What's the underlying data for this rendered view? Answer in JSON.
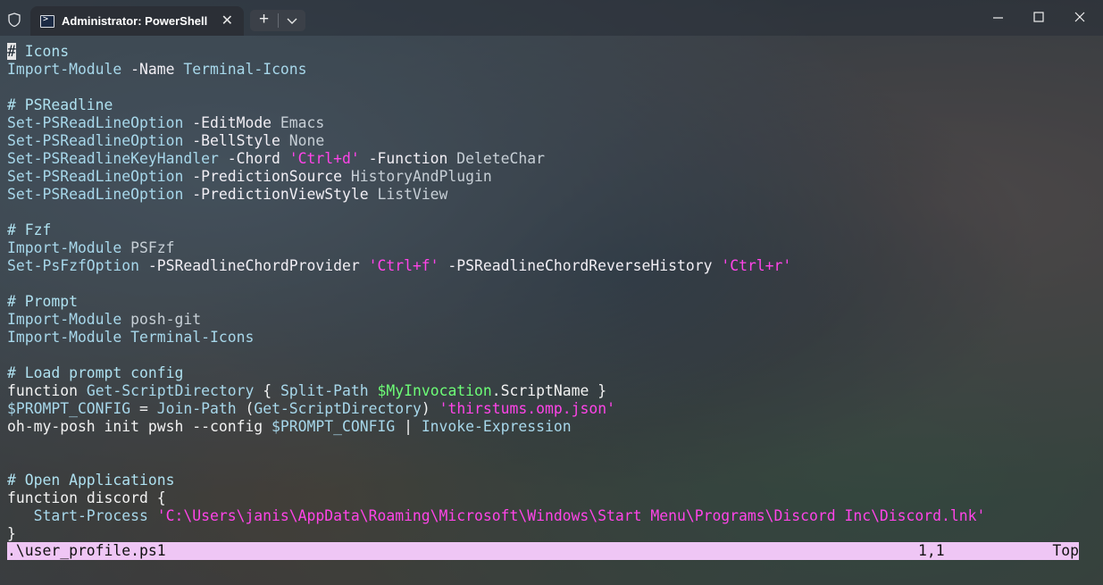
{
  "window": {
    "tab_title": "Administrator: PowerShell",
    "tab_icon": "powershell-icon",
    "caption_icons": [
      "minimize-icon",
      "maximize-icon",
      "close-icon"
    ]
  },
  "editor": {
    "lines": [
      [
        {
          "t": "#",
          "c": "cursor"
        },
        {
          "t": " Icons",
          "c": "c-com"
        }
      ],
      [
        {
          "t": "Import-Module",
          "c": "c-cmd"
        },
        {
          "t": " -Name",
          "c": "c-param"
        },
        {
          "t": " Terminal-Icons",
          "c": "c-cmd"
        }
      ],
      [],
      [
        {
          "t": "# PSReadline",
          "c": "c-com"
        }
      ],
      [
        {
          "t": "Set-PSReadLineOption",
          "c": "c-cmd"
        },
        {
          "t": " -EditMode",
          "c": "c-param"
        },
        {
          "t": " Emacs",
          "c": "c-arg"
        }
      ],
      [
        {
          "t": "Set-PSReadlineOption",
          "c": "c-cmd"
        },
        {
          "t": " -BellStyle",
          "c": "c-param"
        },
        {
          "t": " None",
          "c": "c-arg"
        }
      ],
      [
        {
          "t": "Set-PSReadlineKeyHandler",
          "c": "c-cmd"
        },
        {
          "t": " -Chord",
          "c": "c-param"
        },
        {
          "t": " 'Ctrl+d'",
          "c": "c-str"
        },
        {
          "t": " -Function",
          "c": "c-param"
        },
        {
          "t": " DeleteChar",
          "c": "c-arg"
        }
      ],
      [
        {
          "t": "Set-PSReadLineOption",
          "c": "c-cmd"
        },
        {
          "t": " -PredictionSource",
          "c": "c-param"
        },
        {
          "t": " HistoryAndPlugin",
          "c": "c-arg"
        }
      ],
      [
        {
          "t": "Set-PSReadLineOption",
          "c": "c-cmd"
        },
        {
          "t": " -PredictionViewStyle",
          "c": "c-param"
        },
        {
          "t": " ListView",
          "c": "c-arg"
        }
      ],
      [],
      [
        {
          "t": "# Fzf",
          "c": "c-com"
        }
      ],
      [
        {
          "t": "Import-Module",
          "c": "c-cmd"
        },
        {
          "t": " PSFzf",
          "c": "c-arg"
        }
      ],
      [
        {
          "t": "Set-PsFzfOption",
          "c": "c-cmd"
        },
        {
          "t": " -PSReadlineChordProvider",
          "c": "c-param"
        },
        {
          "t": " 'Ctrl+f'",
          "c": "c-str"
        },
        {
          "t": " -PSReadlineChordReverseHistory",
          "c": "c-param"
        },
        {
          "t": " 'Ctrl+r'",
          "c": "c-str"
        }
      ],
      [],
      [
        {
          "t": "# Prompt",
          "c": "c-com"
        }
      ],
      [
        {
          "t": "Import-Module",
          "c": "c-cmd"
        },
        {
          "t": " posh-git",
          "c": "c-arg"
        }
      ],
      [
        {
          "t": "Import-Module",
          "c": "c-cmd"
        },
        {
          "t": " Terminal-Icons",
          "c": "c-cmd"
        }
      ],
      [],
      [
        {
          "t": "# Load prompt config",
          "c": "c-com"
        }
      ],
      [
        {
          "t": "function",
          "c": "c-kw"
        },
        {
          "t": " Get-ScriptDirectory",
          "c": "c-cmd"
        },
        {
          "t": " { ",
          "c": "c-kw"
        },
        {
          "t": "Split-Path",
          "c": "c-cmd"
        },
        {
          "t": " ",
          "c": "c-kw"
        },
        {
          "t": "$MyInvocation",
          "c": "c-var"
        },
        {
          "t": ".ScriptName",
          "c": "c-kw"
        },
        {
          "t": " }",
          "c": "c-kw"
        }
      ],
      [
        {
          "t": "$PROMPT_CONFIG",
          "c": "c-cmd"
        },
        {
          "t": " = ",
          "c": "c-kw"
        },
        {
          "t": "Join-Path",
          "c": "c-cmd"
        },
        {
          "t": " (",
          "c": "c-kw"
        },
        {
          "t": "Get-ScriptDirectory",
          "c": "c-cmd"
        },
        {
          "t": ") ",
          "c": "c-kw"
        },
        {
          "t": "'thirstums.omp.json'",
          "c": "c-str"
        }
      ],
      [
        {
          "t": "oh-my-posh init pwsh --config ",
          "c": "c-kw"
        },
        {
          "t": "$PROMPT_CONFIG",
          "c": "c-cmd"
        },
        {
          "t": " | ",
          "c": "c-kw"
        },
        {
          "t": "Invoke-Expression",
          "c": "c-cmd"
        }
      ],
      [],
      [],
      [
        {
          "t": "# Open Applications",
          "c": "c-com"
        }
      ],
      [
        {
          "t": "function",
          "c": "c-kw"
        },
        {
          "t": " discord {",
          "c": "c-kw"
        }
      ],
      [
        {
          "t": "   Start-Process",
          "c": "c-cmd"
        },
        {
          "t": " 'C:\\Users\\janis\\AppData\\Roaming\\Microsoft\\Windows\\Start Menu\\Programs\\Discord Inc\\Discord.lnk'",
          "c": "c-str"
        }
      ],
      [
        {
          "t": "}",
          "c": "c-kw"
        }
      ]
    ]
  },
  "statusbar": {
    "file": ".\\user_profile.ps1",
    "position": "1,1",
    "scroll": "Top"
  }
}
